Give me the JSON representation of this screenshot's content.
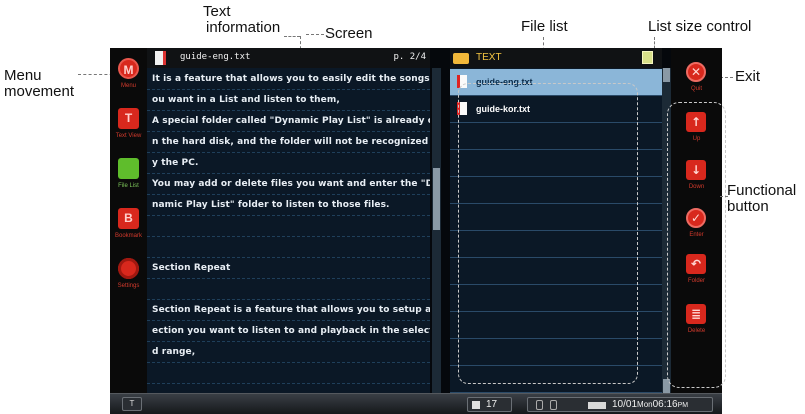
{
  "annotations": {
    "text_information": [
      "Text",
      "information"
    ],
    "screen": "Screen",
    "file_list": "File list",
    "list_size_control": "List size control",
    "menu_movement": [
      "Menu",
      "movement"
    ],
    "exit": "Exit",
    "functional_button": [
      "Functional",
      "button"
    ]
  },
  "left_menu": [
    {
      "label": "Menu",
      "icon": "menu-icon",
      "glyph": "M"
    },
    {
      "label": "Text View",
      "icon": "text-view-icon",
      "glyph": "T"
    },
    {
      "label": "File List",
      "icon": "folder-icon",
      "glyph": ""
    },
    {
      "label": "Bookmark",
      "icon": "bookmark-icon",
      "glyph": "B"
    },
    {
      "label": "Settings",
      "icon": "gear-icon",
      "glyph": ""
    }
  ],
  "text_view": {
    "file_name": "guide-eng.txt",
    "page": "p. 2/4",
    "lines": [
      "It is a feature that allows you to easily edit the songs y",
      "ou want in a List and listen to them,",
      "A special folder called \"Dynamic Play List\" is already o",
      "n the hard disk, and the folder will not be recognized b",
      "y the PC.",
      "You may add or delete files you want and enter the \"Dy",
      "namic Play List\" folder to listen to those files.",
      "",
      "",
      "Section Repeat",
      "",
      "Section Repeat is a feature that allows you to setup a s",
      "ection you want to listen to and playback in the selecte",
      "d range,",
      ""
    ]
  },
  "file_list": {
    "folder": "TEXT",
    "files": [
      "guide-eng.txt",
      "guide-kor.txt"
    ],
    "selected_index": 0
  },
  "right_menu": [
    {
      "label": "Quit",
      "icon": "close-icon",
      "glyph": "✕"
    },
    {
      "label": "Up",
      "icon": "arrow-up-icon",
      "glyph": "↑"
    },
    {
      "label": "Down",
      "icon": "arrow-down-icon",
      "glyph": "↓"
    },
    {
      "label": "Enter",
      "icon": "checkmark-icon",
      "glyph": "✓"
    },
    {
      "label": "Folder",
      "icon": "back-icon",
      "glyph": "↶"
    },
    {
      "label": "Delete",
      "icon": "delete-icon",
      "glyph": "≣"
    }
  ],
  "status": {
    "button_glyph": "T",
    "volume": "17",
    "date_time": "10/01",
    "day": "Mon",
    "time": "06:16",
    "ampm": "PM"
  }
}
